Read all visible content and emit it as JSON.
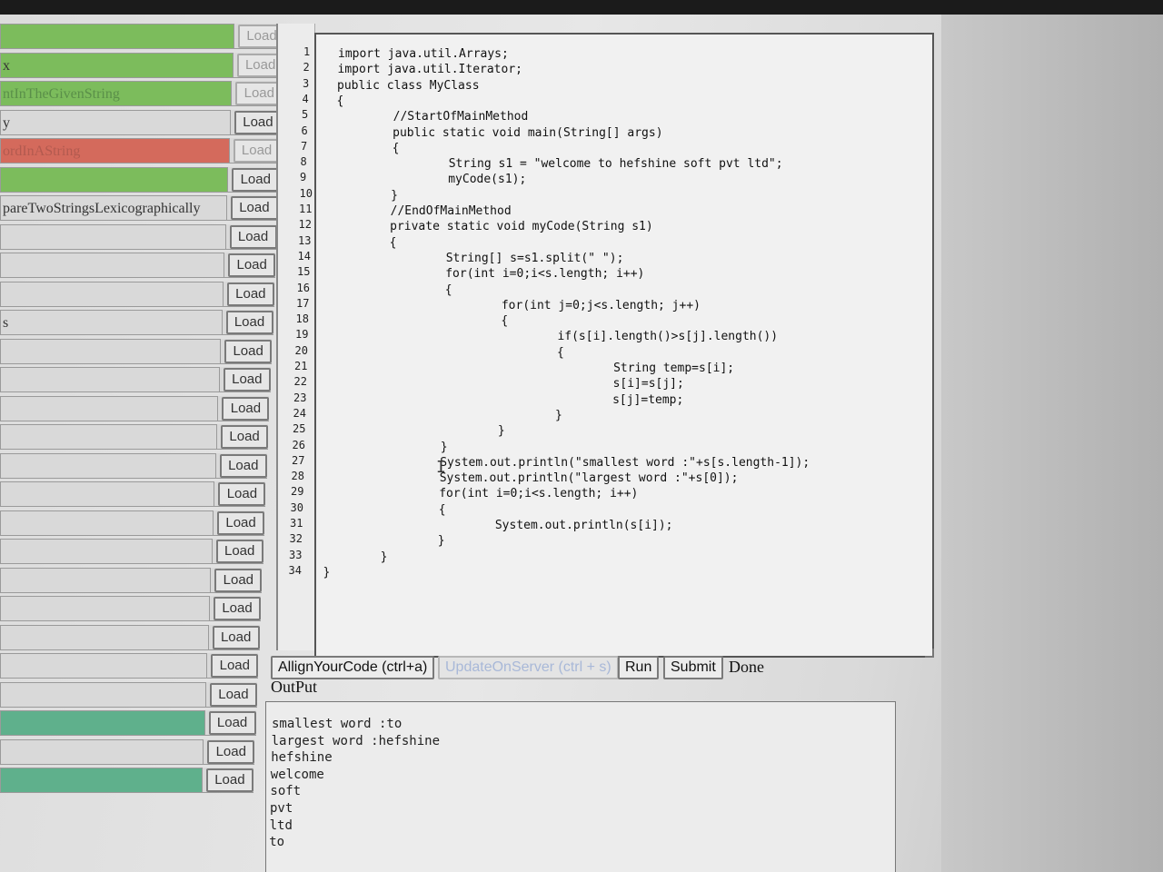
{
  "problems": [
    {
      "name": "",
      "style": "green",
      "load": "Load"
    },
    {
      "name": "x",
      "style": "green dark",
      "load": "Load"
    },
    {
      "name": "ntInTheGivenString",
      "style": "green",
      "load": "Load"
    },
    {
      "name": "y",
      "style": "dark",
      "load": "Load"
    },
    {
      "name": "ordInAString",
      "style": "red",
      "load": "Load"
    },
    {
      "name": "",
      "style": "green",
      "load": "Load"
    },
    {
      "name": "pareTwoStringsLexicographically",
      "style": "dark",
      "load": "Load"
    },
    {
      "name": "",
      "style": "",
      "load": "Load"
    },
    {
      "name": "",
      "style": "",
      "load": "Load"
    },
    {
      "name": "",
      "style": "",
      "load": "Load"
    },
    {
      "name": "s",
      "style": "dark",
      "load": "Load"
    },
    {
      "name": "",
      "style": "",
      "load": "Load"
    },
    {
      "name": "",
      "style": "",
      "load": "Load"
    },
    {
      "name": "",
      "style": "",
      "load": "Load"
    },
    {
      "name": "",
      "style": "",
      "load": "Load"
    },
    {
      "name": "",
      "style": "",
      "load": "Load"
    },
    {
      "name": "",
      "style": "",
      "load": "Load"
    },
    {
      "name": "",
      "style": "",
      "load": "Load"
    },
    {
      "name": "",
      "style": "",
      "load": "Load"
    },
    {
      "name": "",
      "style": "",
      "load": "Load"
    },
    {
      "name": "",
      "style": "",
      "load": "Load"
    },
    {
      "name": "",
      "style": "",
      "load": "Load"
    },
    {
      "name": "",
      "style": "",
      "load": "Load"
    },
    {
      "name": "",
      "style": "",
      "load": "Load"
    },
    {
      "name": "",
      "style": "teal",
      "load": "Load"
    },
    {
      "name": "",
      "style": "",
      "load": "Load"
    },
    {
      "name": "",
      "style": "teal",
      "load": "Load"
    }
  ],
  "editor": {
    "code_lines": [
      "import java.util.Arrays;",
      "import java.util.Iterator;",
      "public class MyClass",
      "{",
      "        //StartOfMainMethod",
      "        public static void main(String[] args)",
      "        {",
      "                String s1 = \"welcome to hefshine soft pvt ltd\";",
      "                myCode(s1);",
      "        }",
      "        //EndOfMainMethod",
      "        private static void myCode(String s1)",
      "        {",
      "                String[] s=s1.split(\" \");",
      "                for(int i=0;i<s.length; i++)",
      "                {",
      "                        for(int j=0;j<s.length; j++)",
      "                        {",
      "                                if(s[i].length()>s[j].length())",
      "                                {",
      "                                        String temp=s[i];",
      "                                        s[i]=s[j];",
      "                                        s[j]=temp;",
      "                                }",
      "                        }",
      "                }",
      "                System.out.println(\"smallest word :\"+s[s.length-1]);",
      "                System.out.println(\"largest word :\"+s[0]);",
      "                for(int i=0;i<s.length; i++)",
      "                {",
      "                        System.out.println(s[i]);",
      "                }",
      "        }",
      "}"
    ]
  },
  "toolbar": {
    "align_label": "AllignYourCode (ctrl+a)",
    "update_label": "UpdateOnServer (ctrl + s)",
    "run_label": "Run",
    "submit_label": "Submit",
    "status": "Done"
  },
  "output": {
    "label": "OutPut",
    "lines": [
      "smallest word :to",
      "largest word :hefshine",
      "hefshine",
      "welcome",
      "soft",
      "pvt",
      "ltd",
      "to"
    ]
  }
}
